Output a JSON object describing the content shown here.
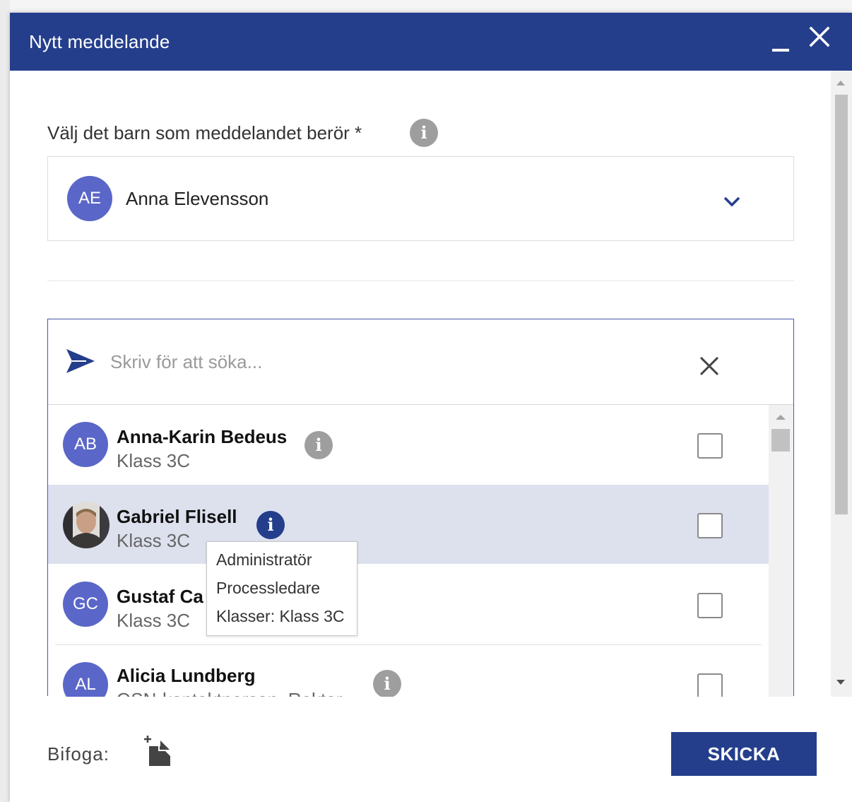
{
  "dialog": {
    "title": "Nytt meddelande"
  },
  "child_select": {
    "label": "Välj det barn som meddelandet berör *",
    "selected_initials": "AE",
    "selected_name": "Anna Elevensson"
  },
  "search": {
    "placeholder": "Skriv för att söka..."
  },
  "recipients": [
    {
      "initials": "AB",
      "name": "Anna-Karin Bedeus",
      "subtitle": "Klass 3C",
      "selected": false,
      "checked": false
    },
    {
      "initials": "",
      "name": "Gabriel Flisell",
      "subtitle": "Klass 3C",
      "selected": true,
      "checked": false
    },
    {
      "initials": "GC",
      "name": "Gustaf Ca",
      "subtitle": "Klass 3C",
      "selected": false,
      "checked": false
    },
    {
      "initials": "AL",
      "name": "Alicia Lundberg",
      "subtitle": "OSN-kontaktperson, Rektor",
      "selected": false,
      "checked": false
    }
  ],
  "tooltip": {
    "lines": [
      "Administratör",
      "Processledare",
      "Klasser: Klass 3C"
    ]
  },
  "footer": {
    "attach_label": "Bifoga:",
    "send_label": "SKICKA"
  },
  "colors": {
    "brand": "#243e8c",
    "avatar": "#5a67c8",
    "selected_row": "#dde1ee",
    "info_gray": "#9e9e9e"
  },
  "icons": {
    "close": "close-icon",
    "minimize": "minimize-icon",
    "info": "info-icon",
    "send": "send-icon",
    "attach": "attach-file-icon",
    "chevron": "chevron-down-icon"
  }
}
